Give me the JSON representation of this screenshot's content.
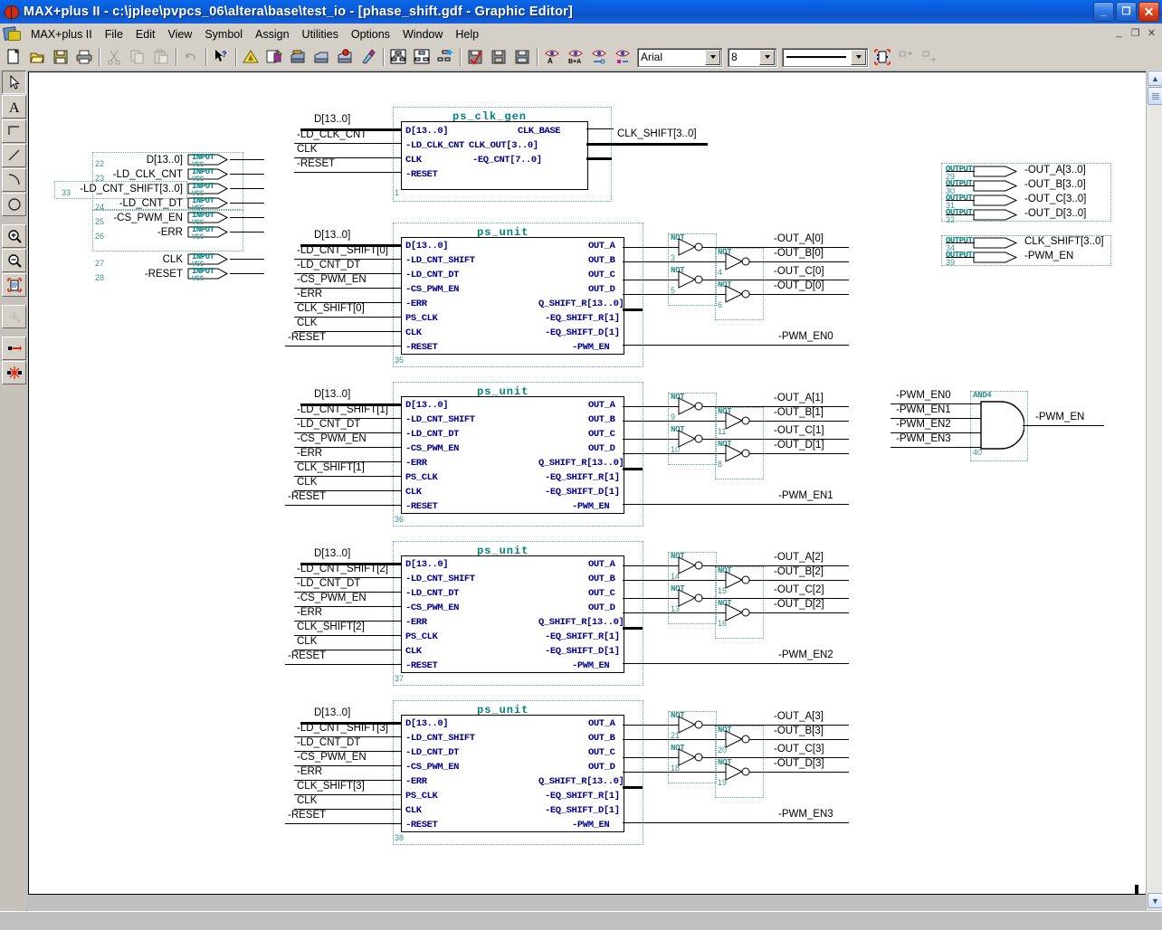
{
  "window": {
    "title": "MAX+plus II - c:\\jplee\\pvpcs_06\\altera\\base\\test_io - [phase_shift.gdf - Graphic Editor]",
    "minimize_label": "_",
    "restore_label": "❐",
    "close_label": "✕",
    "mdi_minimize": "_",
    "mdi_restore": "❐",
    "mdi_close": "✕"
  },
  "menu": {
    "items": [
      {
        "label": "MAX+plus II"
      },
      {
        "label": "File"
      },
      {
        "label": "Edit"
      },
      {
        "label": "View"
      },
      {
        "label": "Symbol"
      },
      {
        "label": "Assign"
      },
      {
        "label": "Utilities"
      },
      {
        "label": "Options"
      },
      {
        "label": "Window"
      },
      {
        "label": "Help"
      }
    ]
  },
  "toolbar": {
    "buttons": [
      "new-file-icon",
      "open-file-icon",
      "save-file-icon",
      "print-icon",
      "cut-icon",
      "copy-icon",
      "paste-icon",
      "undo-icon",
      "context-help-icon",
      "compiler-icon",
      "simulator-icon",
      "timing-analyzer-icon",
      "programmer-icon",
      "message-processor-icon",
      "floorplan-editor-icon",
      "hierarchy-display-icon",
      "project-save-check-icon",
      "project-save-compile-icon",
      "project-save-simulate-icon",
      "save-check-icon",
      "save-compile-icon",
      "save-simulate-icon",
      "find-text-icon",
      "find-node-icon",
      "find-next-icon",
      "find-previous-icon"
    ],
    "font_value": "Arial",
    "size_value": "8",
    "line_value": "solid-line",
    "symbol_button": "symbol-props-icon",
    "align_left_button": "align-icon-1",
    "align_right_button": "align-icon-2"
  },
  "palette": {
    "tools": [
      {
        "name": "selection-tool",
        "state": "pressed"
      },
      {
        "name": "text-tool",
        "state": "normal"
      },
      {
        "name": "orthogonal-line-tool",
        "state": "normal"
      },
      {
        "name": "diagonal-line-tool",
        "state": "normal"
      },
      {
        "name": "arc-tool",
        "state": "normal"
      },
      {
        "name": "circle-tool",
        "state": "normal"
      },
      {
        "name": "zoom-in-tool",
        "state": "normal"
      },
      {
        "name": "zoom-out-tool",
        "state": "normal"
      },
      {
        "name": "fit-in-window-tool",
        "state": "normal"
      },
      {
        "name": "node-snap-tool",
        "state": "disabled"
      },
      {
        "name": "rubberbanding-tool",
        "state": "normal"
      },
      {
        "name": "flip-tool",
        "state": "normal"
      }
    ]
  },
  "schematic": {
    "input_pins": {
      "type_label": "INPUT",
      "vcc_label": "VCC",
      "items": [
        {
          "num": "22",
          "label": "D[13..0]"
        },
        {
          "num": "23",
          "label": "-LD_CLK_CNT"
        },
        {
          "num": "33",
          "label": "-LD_CNT_SHIFT[3..0]"
        },
        {
          "num": "24",
          "label": "-LD_CNT_DT"
        },
        {
          "num": "25",
          "label": "-CS_PWM_EN"
        },
        {
          "num": "26",
          "label": "-ERR"
        },
        {
          "num": "27",
          "label": "CLK"
        },
        {
          "num": "28",
          "label": "-RESET"
        }
      ]
    },
    "output_pins": {
      "type_label": "OUTPUT",
      "group_a": [
        {
          "num": "29",
          "label": "-OUT_A[3..0]"
        },
        {
          "num": "30",
          "label": "-OUT_B[3..0]"
        },
        {
          "num": "31",
          "label": "-OUT_C[3..0]"
        },
        {
          "num": "32",
          "label": "-OUT_D[3..0]"
        }
      ],
      "group_b": [
        {
          "num": "34",
          "label": "CLK_SHIFT[3..0]"
        },
        {
          "num": "39",
          "label": "-PWM_EN"
        }
      ]
    },
    "clk_gen_block": {
      "title": "ps_clk_gen",
      "num": "1",
      "inputs": [
        "D[13..0]",
        "-LD_CLK_CNT",
        "CLK",
        "-RESET"
      ],
      "outputs": [
        "CLK_BASE",
        "CLK_OUT[3..0]",
        "-EQ_CNT[7..0]"
      ],
      "wire_labels_in": [
        "D[13..0]",
        "-LD_CLK_CNT",
        "CLK",
        "-RESET"
      ],
      "wire_label_out": "CLK_SHIFT[3..0]"
    },
    "ps_units": [
      {
        "title": "ps_unit",
        "num": "35",
        "inputs": [
          "D[13..0]",
          "-LD_CNT_SHIFT",
          "-LD_CNT_DT",
          "-CS_PWM_EN",
          "-ERR",
          "PS_CLK",
          "CLK",
          "-RESET"
        ],
        "outputs": [
          "OUT_A",
          "OUT_B",
          "OUT_C",
          "OUT_D",
          "Q_SHIFT_R[13..0]",
          "-EQ_SHIFT_R[1]",
          "-EQ_SHIFT_D[1]",
          "-PWM_EN"
        ],
        "wire_labels_in": [
          "D[13..0]",
          "-LD_CNT_SHIFT[0]",
          "-LD_CNT_DT",
          "-CS_PWM_EN",
          "-ERR",
          "CLK_SHIFT[0]",
          "CLK",
          "-RESET"
        ],
        "not_gates": [
          {
            "label": "NOT",
            "num": "3"
          },
          {
            "label": "NOT",
            "num": "5"
          },
          {
            "label": "NOT",
            "num": "4"
          },
          {
            "label": "NOT",
            "num": "6"
          }
        ],
        "wire_labels_out": [
          "-OUT_A[0]",
          "-OUT_B[0]",
          "-OUT_C[0]",
          "-OUT_D[0]"
        ],
        "pwm_label": "-PWM_EN0"
      },
      {
        "title": "ps_unit",
        "num": "36",
        "inputs": [
          "D[13..0]",
          "-LD_CNT_SHIFT",
          "-LD_CNT_DT",
          "-CS_PWM_EN",
          "-ERR",
          "PS_CLK",
          "CLK",
          "-RESET"
        ],
        "outputs": [
          "OUT_A",
          "OUT_B",
          "OUT_C",
          "OUT_D",
          "Q_SHIFT_R[13..0]",
          "-EQ_SHIFT_R[1]",
          "-EQ_SHIFT_D[1]",
          "-PWM_EN"
        ],
        "wire_labels_in": [
          "D[13..0]",
          "-LD_CNT_SHIFT[1]",
          "-LD_CNT_DT",
          "-CS_PWM_EN",
          "-ERR",
          "CLK_SHIFT[1]",
          "CLK",
          "-RESET"
        ],
        "not_gates": [
          {
            "label": "NOT",
            "num": "9"
          },
          {
            "label": "NOT",
            "num": "10"
          },
          {
            "label": "NOT",
            "num": "11"
          },
          {
            "label": "NOT",
            "num": "8"
          }
        ],
        "wire_labels_out": [
          "-OUT_A[1]",
          "-OUT_B[1]",
          "-OUT_C[1]",
          "-OUT_D[1]"
        ],
        "pwm_label": "-PWM_EN1"
      },
      {
        "title": "ps_unit",
        "num": "37",
        "inputs": [
          "D[13..0]",
          "-LD_CNT_SHIFT",
          "-LD_CNT_DT",
          "-CS_PWM_EN",
          "-ERR",
          "PS_CLK",
          "CLK",
          "-RESET"
        ],
        "outputs": [
          "OUT_A",
          "OUT_B",
          "OUT_C",
          "OUT_D",
          "Q_SHIFT_R[13..0]",
          "-EQ_SHIFT_R[1]",
          "-EQ_SHIFT_D[1]",
          "-PWM_EN"
        ],
        "wire_labels_in": [
          "D[13..0]",
          "-LD_CNT_SHIFT[2]",
          "-LD_CNT_DT",
          "-CS_PWM_EN",
          "-ERR",
          "CLK_SHIFT[2]",
          "CLK",
          "-RESET"
        ],
        "not_gates": [
          {
            "label": "NOT",
            "num": "14"
          },
          {
            "label": "NOT",
            "num": "13"
          },
          {
            "label": "NOT",
            "num": "15"
          },
          {
            "label": "NOT",
            "num": "16"
          }
        ],
        "wire_labels_out": [
          "-OUT_A[2]",
          "-OUT_B[2]",
          "-OUT_C[2]",
          "-OUT_D[2]"
        ],
        "pwm_label": "-PWM_EN2"
      },
      {
        "title": "ps_unit",
        "num": "38",
        "inputs": [
          "D[13..0]",
          "-LD_CNT_SHIFT",
          "-LD_CNT_DT",
          "-CS_PWM_EN",
          "-ERR",
          "PS_CLK",
          "CLK",
          "-RESET"
        ],
        "outputs": [
          "OUT_A",
          "OUT_B",
          "OUT_C",
          "OUT_D",
          "Q_SHIFT_R[13..0]",
          "-EQ_SHIFT_R[1]",
          "-EQ_SHIFT_D[1]",
          "-PWM_EN"
        ],
        "wire_labels_in": [
          "D[13..0]",
          "-LD_CNT_SHIFT[3]",
          "-LD_CNT_DT",
          "-CS_PWM_EN",
          "-ERR",
          "CLK_SHIFT[3]",
          "CLK",
          "-RESET"
        ],
        "not_gates": [
          {
            "label": "NOT",
            "num": "21"
          },
          {
            "label": "NOT",
            "num": "18"
          },
          {
            "label": "NOT",
            "num": "20"
          },
          {
            "label": "NOT",
            "num": "19"
          }
        ],
        "wire_labels_out": [
          "-OUT_A[3]",
          "-OUT_B[3]",
          "-OUT_C[3]",
          "-OUT_D[3]"
        ],
        "pwm_label": "-PWM_EN3"
      }
    ],
    "and_gate": {
      "label": "AND4",
      "num": "40",
      "inputs": [
        "-PWM_EN0",
        "-PWM_EN1",
        "-PWM_EN2",
        "-PWM_EN3"
      ],
      "output": "-PWM_EN"
    }
  },
  "colors": {
    "title_blue": "#0a5ad6",
    "block_label_blue": "#00008c",
    "block_title_teal": "#008080",
    "symbol_num_teal": "#3a8f8f",
    "chrome_gray": "#d4d0c8"
  }
}
